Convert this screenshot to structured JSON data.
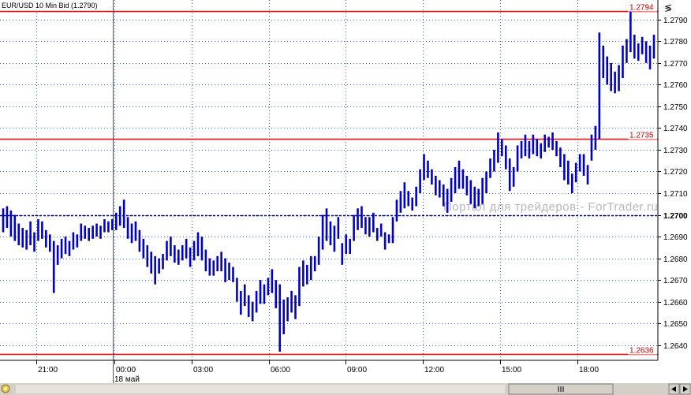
{
  "window": {
    "title": "EUR/USD 10 Min Bid (1.2790)",
    "watermark": "Портал для трейдеров - ForTrader.ru",
    "corner_glyph": "≶",
    "accent": "#0000cc",
    "hline_color": "#ff0000",
    "grid_color": "#3366cc"
  },
  "chart_data": {
    "type": "bar",
    "subtype": "ohlc-price-bars",
    "ylim": [
      1.2633,
      1.2799
    ],
    "y_ticks": [
      "1.2790",
      "1.2780",
      "1.2770",
      "1.2760",
      "1.2750",
      "1.2740",
      "1.2730",
      "1.2720",
      "1.2710",
      "1.2700",
      "1.2690",
      "1.2680",
      "1.2670",
      "1.2660",
      "1.2650",
      "1.2640"
    ],
    "x_ticks": [
      "21:00",
      "00:00",
      "03:00",
      "06:00",
      "09:00",
      "12:00",
      "15:00",
      "18:00"
    ],
    "date_label": "18 май",
    "horizontal_lines": [
      {
        "value": 1.2794,
        "label": "1.2794",
        "style": "solid"
      },
      {
        "value": 1.2735,
        "label": "1.2735",
        "style": "solid"
      },
      {
        "value": 1.27,
        "label": "1.2700",
        "style": "dashed"
      },
      {
        "value": 1.2636,
        "label": "1.2636",
        "style": "solid"
      }
    ],
    "series": [
      {
        "values": [
          [
            1.2703,
            1.2692
          ],
          [
            1.2704,
            1.2694
          ],
          [
            1.2702,
            1.269
          ],
          [
            1.27,
            1.2688
          ],
          [
            1.2696,
            1.2686
          ],
          [
            1.2694,
            1.2685
          ],
          [
            1.2693,
            1.2684
          ],
          [
            1.2697,
            1.2686
          ],
          [
            1.2692,
            1.2683
          ],
          [
            1.2698,
            1.2688
          ],
          [
            1.2697,
            1.2689
          ],
          [
            1.2693,
            1.2685
          ],
          [
            1.2691,
            1.2683
          ],
          [
            1.2688,
            1.2664
          ],
          [
            1.2686,
            1.2677
          ],
          [
            1.2689,
            1.268
          ],
          [
            1.269,
            1.2682
          ],
          [
            1.2688,
            1.2681
          ],
          [
            1.2692,
            1.2684
          ],
          [
            1.2691,
            1.2685
          ],
          [
            1.2696,
            1.2688
          ],
          [
            1.2695,
            1.2689
          ],
          [
            1.2694,
            1.2688
          ],
          [
            1.2695,
            1.2689
          ],
          [
            1.2696,
            1.269
          ],
          [
            1.2695,
            1.2689
          ],
          [
            1.2698,
            1.2692
          ],
          [
            1.2697,
            1.2692
          ],
          [
            1.2698,
            1.2693
          ],
          [
            1.2701,
            1.2693
          ],
          [
            1.2704,
            1.2695
          ],
          [
            1.2707,
            1.2694
          ],
          [
            1.2699,
            1.2689
          ],
          [
            1.2696,
            1.2687
          ],
          [
            1.2697,
            1.2688
          ],
          [
            1.2693,
            1.2683
          ],
          [
            1.2689,
            1.268
          ],
          [
            1.2686,
            1.2676
          ],
          [
            1.2683,
            1.2673
          ],
          [
            1.2681,
            1.2668
          ],
          [
            1.268,
            1.2673
          ],
          [
            1.2682,
            1.2675
          ],
          [
            1.2688,
            1.2679
          ],
          [
            1.269,
            1.2681
          ],
          [
            1.2686,
            1.2678
          ],
          [
            1.2684,
            1.2677
          ],
          [
            1.2686,
            1.2679
          ],
          [
            1.2689,
            1.268
          ],
          [
            1.2685,
            1.2676
          ],
          [
            1.2688,
            1.2679
          ],
          [
            1.2692,
            1.2681
          ],
          [
            1.269,
            1.2679
          ],
          [
            1.2684,
            1.2674
          ],
          [
            1.268,
            1.2672
          ],
          [
            1.2679,
            1.2672
          ],
          [
            1.2681,
            1.2674
          ],
          [
            1.2683,
            1.2674
          ],
          [
            1.268,
            1.2669
          ],
          [
            1.2678,
            1.267
          ],
          [
            1.2676,
            1.2669
          ],
          [
            1.2671,
            1.266
          ],
          [
            1.2665,
            1.2654
          ],
          [
            1.2668,
            1.2658
          ],
          [
            1.2663,
            1.2653
          ],
          [
            1.266,
            1.2651
          ],
          [
            1.2665,
            1.2655
          ],
          [
            1.267,
            1.2659
          ],
          [
            1.2668,
            1.2659
          ],
          [
            1.2671,
            1.2663
          ],
          [
            1.2675,
            1.2664
          ],
          [
            1.267,
            1.2657
          ],
          [
            1.2668,
            1.2637
          ],
          [
            1.2661,
            1.2645
          ],
          [
            1.2662,
            1.2651
          ],
          [
            1.2665,
            1.2655
          ],
          [
            1.2663,
            1.2652
          ],
          [
            1.2676,
            1.2658
          ],
          [
            1.2679,
            1.2667
          ],
          [
            1.2677,
            1.2668
          ],
          [
            1.2681,
            1.267
          ],
          [
            1.2681,
            1.2674
          ],
          [
            1.269,
            1.2677
          ],
          [
            1.27,
            1.2684
          ],
          [
            1.2703,
            1.2688
          ],
          [
            1.2697,
            1.2686
          ],
          [
            1.2695,
            1.2683
          ],
          [
            1.2699,
            1.2689
          ],
          [
            1.2687,
            1.2677
          ],
          [
            1.2691,
            1.2682
          ],
          [
            1.2689,
            1.2682
          ],
          [
            1.27,
            1.2688
          ],
          [
            1.2703,
            1.2693
          ],
          [
            1.2704,
            1.2694
          ],
          [
            1.2699,
            1.2691
          ],
          [
            1.2699,
            1.269
          ],
          [
            1.2701,
            1.2692
          ],
          [
            1.2694,
            1.2688
          ],
          [
            1.2696,
            1.269
          ],
          [
            1.2692,
            1.2684
          ],
          [
            1.2691,
            1.2687
          ],
          [
            1.2699,
            1.2687
          ],
          [
            1.2707,
            1.2697
          ],
          [
            1.2711,
            1.2701
          ],
          [
            1.2715,
            1.2703
          ],
          [
            1.2711,
            1.2704
          ],
          [
            1.2708,
            1.2702
          ],
          [
            1.2713,
            1.2704
          ],
          [
            1.2721,
            1.271
          ],
          [
            1.2728,
            1.2716
          ],
          [
            1.2725,
            1.2717
          ],
          [
            1.2721,
            1.2714
          ],
          [
            1.2718,
            1.2709
          ],
          [
            1.2716,
            1.2708
          ],
          [
            1.2714,
            1.2704
          ],
          [
            1.2712,
            1.2701
          ],
          [
            1.2717,
            1.2706
          ],
          [
            1.2722,
            1.271
          ],
          [
            1.2725,
            1.2712
          ],
          [
            1.2721,
            1.2712
          ],
          [
            1.2718,
            1.2709
          ],
          [
            1.2716,
            1.2705
          ],
          [
            1.2713,
            1.2703
          ],
          [
            1.2712,
            1.2704
          ],
          [
            1.2717,
            1.2705
          ],
          [
            1.272,
            1.271
          ],
          [
            1.2726,
            1.2717
          ],
          [
            1.273,
            1.272
          ],
          [
            1.2738,
            1.2724
          ],
          [
            1.2735,
            1.2727
          ],
          [
            1.2732,
            1.2721
          ],
          [
            1.2726,
            1.2711
          ],
          [
            1.2722,
            1.2713
          ],
          [
            1.2732,
            1.272
          ],
          [
            1.2734,
            1.2726
          ],
          [
            1.2737,
            1.2727
          ],
          [
            1.2734,
            1.2726
          ],
          [
            1.2737,
            1.2728
          ],
          [
            1.2735,
            1.2727
          ],
          [
            1.2733,
            1.2726
          ],
          [
            1.2737,
            1.2729
          ],
          [
            1.2736,
            1.2731
          ],
          [
            1.2738,
            1.273
          ],
          [
            1.2734,
            1.2727
          ],
          [
            1.2731,
            1.2722
          ],
          [
            1.2728,
            1.2716
          ],
          [
            1.2725,
            1.2714
          ],
          [
            1.2719,
            1.271
          ],
          [
            1.2724,
            1.2715
          ],
          [
            1.2728,
            1.272
          ],
          [
            1.2728,
            1.2718
          ],
          [
            1.2723,
            1.2714
          ],
          [
            1.2737,
            1.2725
          ],
          [
            1.2741,
            1.273
          ],
          [
            1.2784,
            1.2735
          ],
          [
            1.2778,
            1.2763
          ],
          [
            1.2773,
            1.276
          ],
          [
            1.277,
            1.2757
          ],
          [
            1.2766,
            1.2756
          ],
          [
            1.2769,
            1.2757
          ],
          [
            1.2778,
            1.2763
          ],
          [
            1.2781,
            1.277
          ],
          [
            1.2794,
            1.2775
          ],
          [
            1.2783,
            1.2772
          ],
          [
            1.2779,
            1.2771
          ],
          [
            1.2782,
            1.2774
          ],
          [
            1.278,
            1.277
          ],
          [
            1.2778,
            1.2767
          ],
          [
            1.2783,
            1.2772
          ]
        ]
      }
    ]
  }
}
